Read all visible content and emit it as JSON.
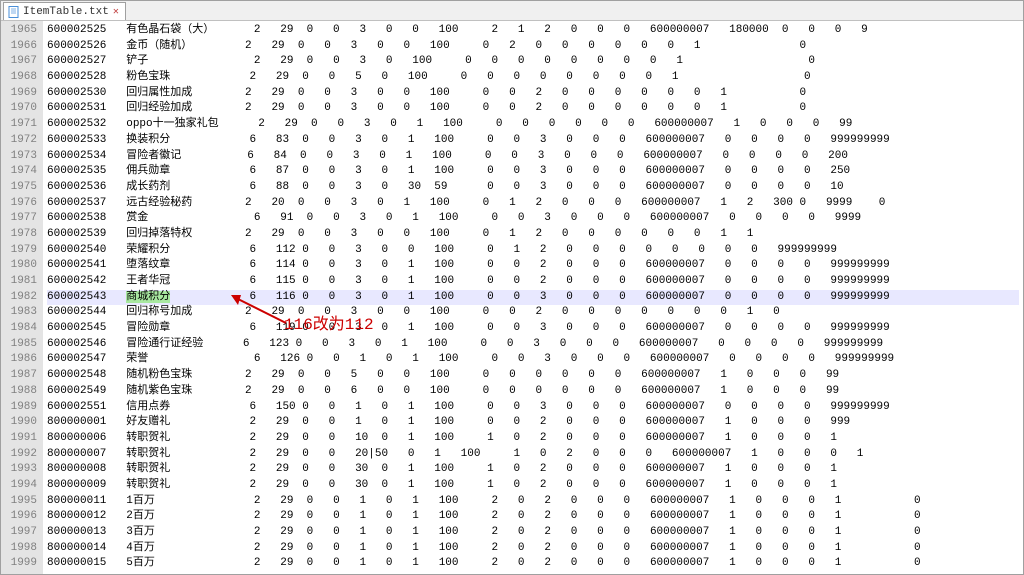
{
  "tab": {
    "filename": "ItemTable.txt"
  },
  "annotation": {
    "text": "116改为112"
  },
  "lines": [
    {
      "no": 1965,
      "id": "600002525",
      "name": "有色晶石袋（大）",
      "cols": "    2   29  0   0   3   0   0   100     2   1   2   0   0   0   600000007   180000  0   0   0   9"
    },
    {
      "no": 1966,
      "id": "600002526",
      "name": "金币（随机）",
      "cols": "  2   29  0   0   3   0   0   100     0   2   0   0   0   0   0   0   1               0"
    },
    {
      "no": 1967,
      "id": "600002527",
      "name": "铲子",
      "cols": "  2   29  0   0   3   0   100     0   0   0   0   0   0   0   0   1                   0"
    },
    {
      "no": 1968,
      "id": "600002528",
      "name": "粉色宝珠",
      "cols": "  2   29  0   0   5   0   100     0   0   0   0   0   0   0   0   1                   0"
    },
    {
      "no": 1969,
      "id": "600002530",
      "name": "回归属性加成",
      "cols": "  2   29  0   0   3   0   0   100     0   0   2   0   0   0   0   0   0   1           0"
    },
    {
      "no": 1970,
      "id": "600002531",
      "name": "回归经验加成",
      "cols": "  2   29  0   0   3   0   0   100     0   0   2   0   0   0   0   0   0   1           0"
    },
    {
      "no": 1971,
      "id": "600002532",
      "name": "oppo十一独家礼包",
      "cols": "    2   29  0   0   3   0   1   100     0   0   0   0   0   0   600000007   1   0   0   0   99"
    },
    {
      "no": 1972,
      "id": "600002533",
      "name": "换装积分",
      "cols": "  6   83  0   0   3   0   1   100     0   0   3   0   0   0   600000007   0   0   0   0   999999999"
    },
    {
      "no": 1973,
      "id": "600002534",
      "name": "冒险者徽记",
      "cols": "  6   84  0   0   3   0   1   100     0   0   3   0   0   0   600000007   0   0   0   0   200"
    },
    {
      "no": 1974,
      "id": "600002535",
      "name": "佣兵勋章",
      "cols": "  6   87  0   0   3   0   1   100     0   0   3   0   0   0   600000007   0   0   0   0   250"
    },
    {
      "no": 1975,
      "id": "600002536",
      "name": "成长药剂",
      "cols": "  6   88  0   0   3   0   30  59      0   0   3   0   0   0   600000007   0   0   0   0   10"
    },
    {
      "no": 1976,
      "id": "600002537",
      "name": "远古经验秘药",
      "cols": "  2   20  0   0   3   0   1   100     0   1   2   0   0   0   600000007   1   2   300 0   9999    0"
    },
    {
      "no": 1977,
      "id": "600002538",
      "name": "赏金",
      "cols": "  6   91  0   0   3   0   1   100     0   0   3   0   0   0   600000007   0   0   0   0   9999"
    },
    {
      "no": 1978,
      "id": "600002539",
      "name": "回归掉落特权",
      "cols": "  2   29  0   0   3   0   0   100     0   1   2   0   0   0   0   0   0   1   1"
    },
    {
      "no": 1979,
      "id": "600002540",
      "name": "荣耀积分",
      "cols": "  6   112 0   0   3   0   0   100     0   1   2   0   0   0   0   0   0   0   0   999999999"
    },
    {
      "no": 1980,
      "id": "600002541",
      "name": "堕落纹章",
      "cols": "  6   114 0   0   3   0   1   100     0   0   2   0   0   0   600000007   0   0   0   0   999999999"
    },
    {
      "no": 1981,
      "id": "600002542",
      "name": "王者华冠",
      "cols": "  6   115 0   0   3   0   1   100     0   0   2   0   0   0   600000007   0   0   0   0   999999999"
    },
    {
      "no": 1982,
      "id": "600002543",
      "name": "商城积分",
      "cols": "  6   116 0   0   3   0   1   100     0   0   3   0   0   0   600000007   0   0   0   0   999999999",
      "selected": true,
      "highlight": true
    },
    {
      "no": 1983,
      "id": "600002544",
      "name": "回归称号加成",
      "cols": "  2   29  0   0   3   0   0   100     0   0   2   0   0   0   0   0   0   0   1   0"
    },
    {
      "no": 1984,
      "id": "600002545",
      "name": "冒险勋章",
      "cols": "  6   119 0   0   3   0   1   100     0   0   3   0   0   0   600000007   0   0   0   0   999999999"
    },
    {
      "no": 1985,
      "id": "600002546",
      "name": "冒险通行证经验",
      "cols": "  6   123 0   0   3   0   1   100     0   0   3   0   0   0   600000007   0   0   0   0   999999999"
    },
    {
      "no": 1986,
      "id": "600002547",
      "name": "荣誉",
      "cols": "  6   126 0   0   1   0   1   100     0   0   3   0   0   0   600000007   0   0   0   0   999999999"
    },
    {
      "no": 1987,
      "id": "600002548",
      "name": "随机粉色宝珠",
      "cols": "  2   29  0   0   5   0   0   100     0   0   0   0   0   0   600000007   1   0   0   0   99"
    },
    {
      "no": 1988,
      "id": "600002549",
      "name": "随机紫色宝珠",
      "cols": "  2   29  0   0   6   0   0   100     0   0   0   0   0   0   600000007   1   0   0   0   99"
    },
    {
      "no": 1989,
      "id": "600002551",
      "name": "信用点券",
      "cols": "  6   150 0   0   1   0   1   100     0   0   3   0   0   0   600000007   0   0   0   0   999999999"
    },
    {
      "no": 1990,
      "id": "800000001",
      "name": "好友赠礼",
      "cols": "  2   29  0   0   1   0   1   100     0   0   2   0   0   0   600000007   1   0   0   0   999"
    },
    {
      "no": 1991,
      "id": "800000006",
      "name": "转职贺礼",
      "cols": "  2   29  0   0   10  0   1   100     1   0   2   0   0   0   600000007   1   0   0   0   1"
    },
    {
      "no": 1992,
      "id": "800000007",
      "name": "转职贺礼",
      "cols": "  2   29  0   0   20|50   0   1   100     1   0   2   0   0   0   600000007   1   0   0   0   1"
    },
    {
      "no": 1993,
      "id": "800000008",
      "name": "转职贺礼",
      "cols": "  2   29  0   0   30  0   1   100     1   0   2   0   0   0   600000007   1   0   0   0   1"
    },
    {
      "no": 1994,
      "id": "800000009",
      "name": "转职贺礼",
      "cols": "  2   29  0   0   30  0   1   100     1   0   2   0   0   0   600000007   1   0   0   0   1"
    },
    {
      "no": 1995,
      "id": "800000011",
      "name": "1百万",
      "cols": "  2   29  0   0   1   0   1   100     2   0   2   0   0   0   600000007   1   0   0   0   1           0"
    },
    {
      "no": 1996,
      "id": "800000012",
      "name": "2百万",
      "cols": "  2   29  0   0   1   0   1   100     2   0   2   0   0   0   600000007   1   0   0   0   1           0"
    },
    {
      "no": 1997,
      "id": "800000013",
      "name": "3百万",
      "cols": "  2   29  0   0   1   0   1   100     2   0   2   0   0   0   600000007   1   0   0   0   1           0"
    },
    {
      "no": 1998,
      "id": "800000014",
      "name": "4百万",
      "cols": "  2   29  0   0   1   0   1   100     2   0   2   0   0   0   600000007   1   0   0   0   1           0"
    },
    {
      "no": 1999,
      "id": "800000015",
      "name": "5百万",
      "cols": "  2   29  0   0   1   0   1   100     2   0   2   0   0   0   600000007   1   0   0   0   1           0"
    }
  ]
}
